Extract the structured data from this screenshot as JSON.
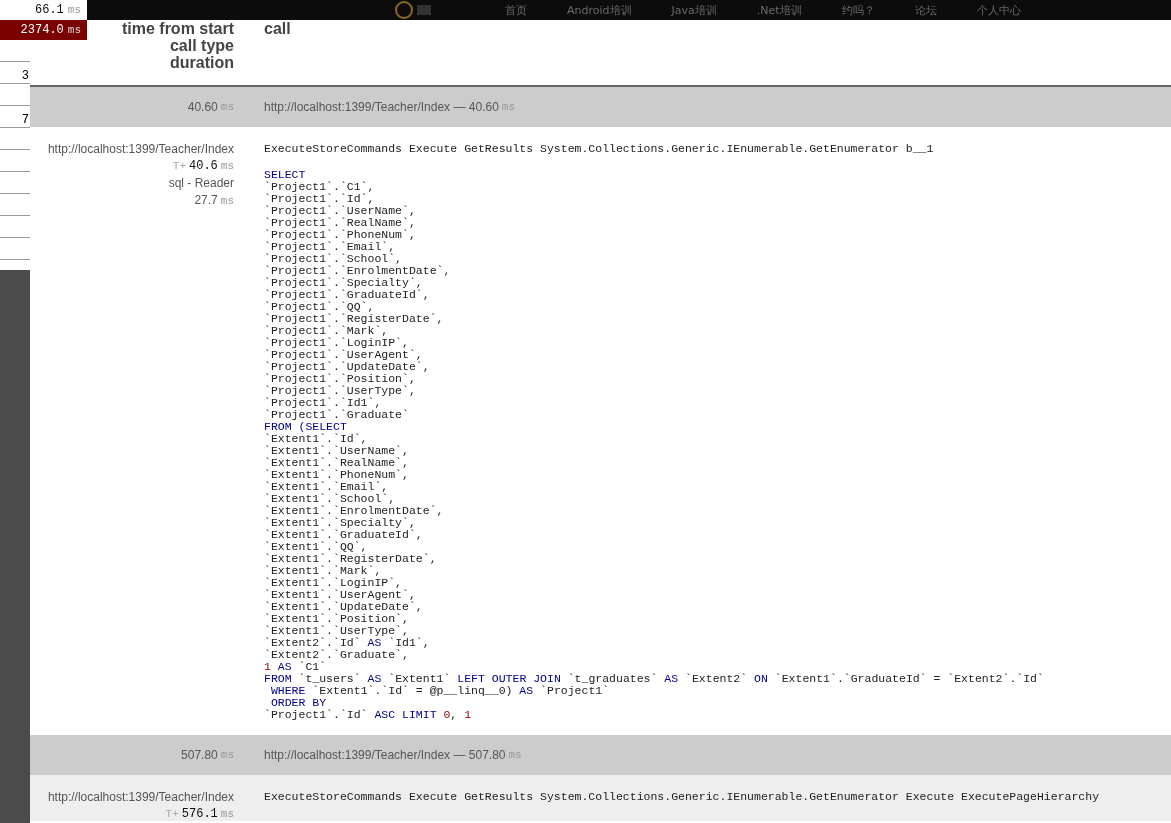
{
  "nav": {
    "items": [
      "首页",
      "Android培训",
      "Java培训",
      ".Net培训",
      "约吗？",
      "论坛",
      "个人中心"
    ]
  },
  "timings": [
    {
      "value": "66.1",
      "unit": "ms",
      "highlighted": false
    },
    {
      "value": "2374.0",
      "unit": "ms",
      "highlighted": true
    }
  ],
  "side_list": [
    {
      "kind": "blank"
    },
    {
      "kind": "numbered",
      "text": "3"
    },
    {
      "kind": "blank"
    },
    {
      "kind": "numbered",
      "text": "7"
    },
    {
      "kind": "blank"
    },
    {
      "kind": "blank"
    },
    {
      "kind": "blank"
    },
    {
      "kind": "blank"
    },
    {
      "kind": "blank"
    },
    {
      "kind": "blank"
    }
  ],
  "table": {
    "columns": [
      [
        "time from start",
        "call type",
        "duration"
      ],
      "call"
    ],
    "rows": [
      {
        "kind": "summary",
        "duration": "40.60",
        "unit": "ms",
        "call": "http://localhost:1399/Teacher/Index — 40.60",
        "call_unit": "ms"
      },
      {
        "kind": "detail",
        "url": "http://localhost:1399/Teacher/Index",
        "start_prefix": "T+",
        "start": "40.6",
        "start_unit": "ms",
        "type": "sql - Reader",
        "duration": "27.7",
        "duration_unit": "ms",
        "stack": "ExecuteStoreCommands Execute GetResults System.Collections.Generic.IEnumerable.GetEnumerator b__1",
        "sql": [
          [
            {
              "kind": "keyword",
              "text": "SELECT"
            }
          ],
          "`Project1`.`C1`,",
          "`Project1`.`Id`,",
          "`Project1`.`UserName`,",
          "`Project1`.`RealName`,",
          "`Project1`.`PhoneNum`,",
          "`Project1`.`Email`,",
          "`Project1`.`School`,",
          "`Project1`.`EnrolmentDate`,",
          "`Project1`.`Specialty`,",
          "`Project1`.`GraduateId`,",
          "`Project1`.`QQ`,",
          "`Project1`.`RegisterDate`,",
          "`Project1`.`Mark`,",
          "`Project1`.`LoginIP`,",
          "`Project1`.`UserAgent`,",
          "`Project1`.`UpdateDate`,",
          "`Project1`.`Position`,",
          "`Project1`.`UserType`,",
          "`Project1`.`Id1`,",
          "`Project1`.`Graduate`",
          [
            {
              "kind": "keyword",
              "text": "FROM (SELECT"
            }
          ],
          "`Extent1`.`Id`,",
          "`Extent1`.`UserName`,",
          "`Extent1`.`RealName`,",
          "`Extent1`.`PhoneNum`,",
          "`Extent1`.`Email`,",
          "`Extent1`.`School`,",
          "`Extent1`.`EnrolmentDate`,",
          "`Extent1`.`Specialty`,",
          "`Extent1`.`GraduateId`,",
          "`Extent1`.`QQ`,",
          "`Extent1`.`RegisterDate`,",
          "`Extent1`.`Mark`,",
          "`Extent1`.`LoginIP`,",
          "`Extent1`.`UserAgent`,",
          "`Extent1`.`UpdateDate`,",
          "`Extent1`.`Position`,",
          "`Extent1`.`UserType`,",
          [
            {
              "kind": "plain",
              "text": "`Extent2`.`Id` "
            },
            {
              "kind": "keyword",
              "text": "AS"
            },
            {
              "kind": "plain",
              "text": " `Id1`,"
            }
          ],
          "`Extent2`.`Graduate`,",
          [
            {
              "kind": "number",
              "text": "1"
            },
            {
              "kind": "keyword",
              "text": " AS"
            },
            {
              "kind": "plain",
              "text": " `C1`"
            }
          ],
          [
            {
              "kind": "keyword",
              "text": "FROM"
            },
            {
              "kind": "plain",
              "text": " `t_users` "
            },
            {
              "kind": "keyword",
              "text": "AS"
            },
            {
              "kind": "plain",
              "text": " `Extent1` "
            },
            {
              "kind": "keyword",
              "text": "LEFT OUTER JOIN"
            },
            {
              "kind": "plain",
              "text": " `t_graduates` "
            },
            {
              "kind": "keyword",
              "text": "AS"
            },
            {
              "kind": "plain",
              "text": " `Extent2` "
            },
            {
              "kind": "keyword",
              "text": "ON"
            },
            {
              "kind": "plain",
              "text": " `Extent1`.`GraduateId` = `Extent2`.`Id`"
            }
          ],
          [
            {
              "kind": "keyword",
              "text": " WHERE"
            },
            {
              "kind": "plain",
              "text": " `Extent1`.`Id` = @p__linq__0) "
            },
            {
              "kind": "keyword",
              "text": "AS"
            },
            {
              "kind": "plain",
              "text": " `Project1`"
            }
          ],
          [
            {
              "kind": "keyword",
              "text": " ORDER BY"
            }
          ],
          [
            {
              "kind": "plain",
              "text": "`Project1`.`Id` "
            },
            {
              "kind": "keyword",
              "text": "ASC LIMIT"
            },
            {
              "kind": "number",
              "text": " 0"
            },
            {
              "kind": "plain",
              "text": ","
            },
            {
              "kind": "number",
              "text": " 1"
            }
          ]
        ]
      },
      {
        "kind": "summary",
        "duration": "507.80",
        "unit": "ms",
        "call": "http://localhost:1399/Teacher/Index — 507.80",
        "call_unit": "ms"
      },
      {
        "kind": "detail",
        "url": "http://localhost:1399/Teacher/Index",
        "start_prefix": "T+",
        "start": "576.1",
        "start_unit": "ms",
        "stack": "ExecuteStoreCommands Execute GetResults System.Collections.Generic.IEnumerable.GetEnumerator Execute ExecutePageHierarchy"
      }
    ]
  }
}
